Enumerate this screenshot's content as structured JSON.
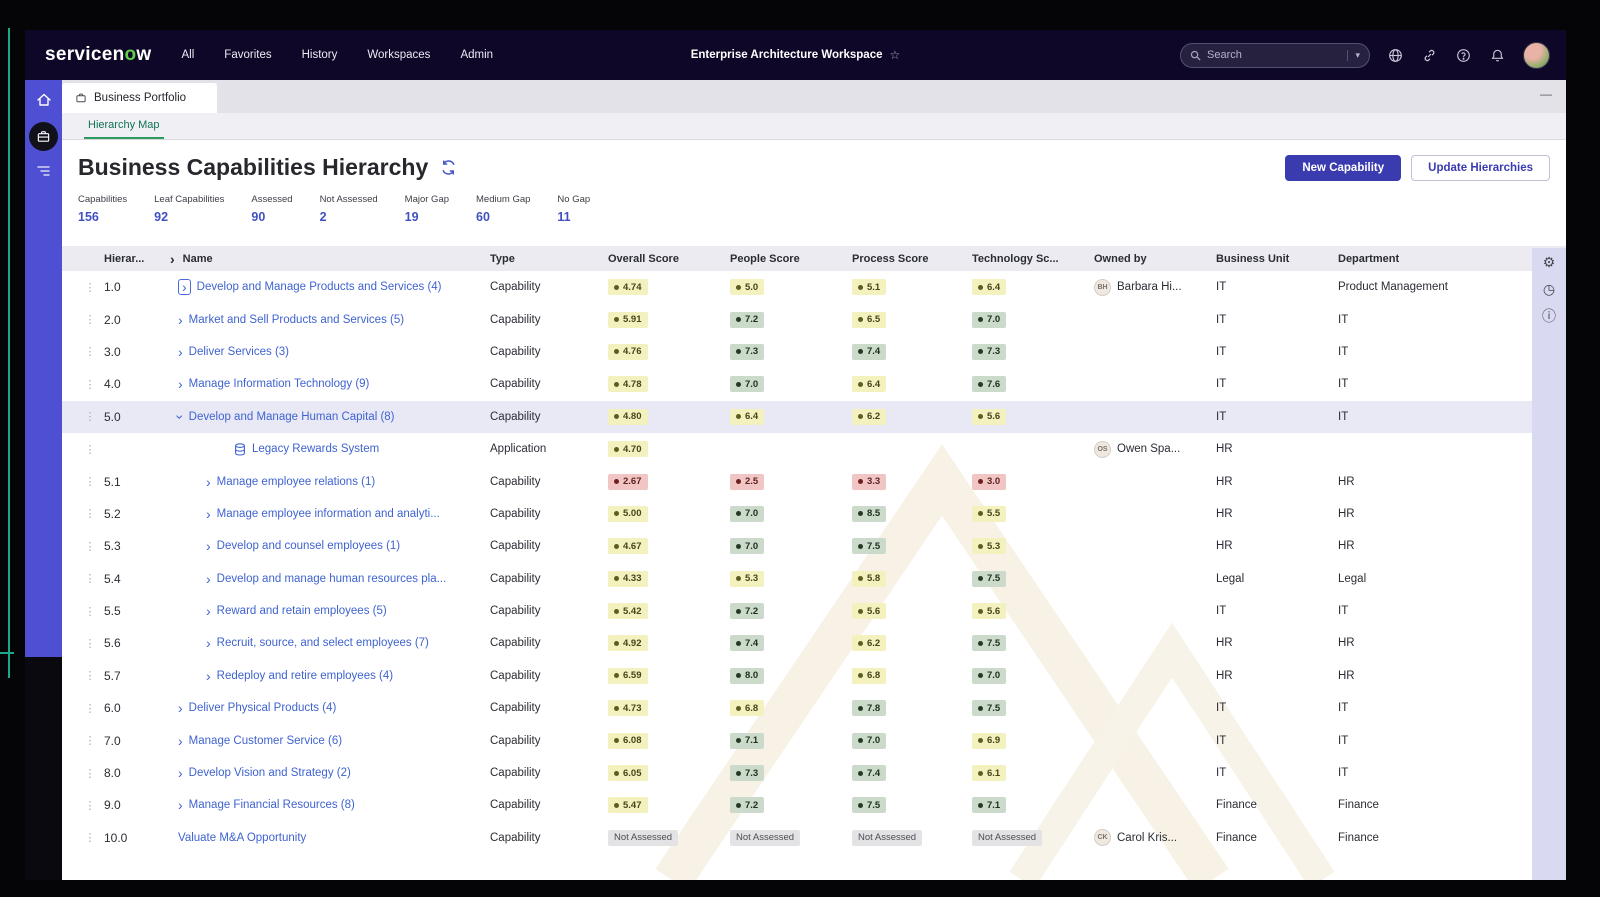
{
  "topnav": {
    "logo": "servicenow",
    "menu": [
      "All",
      "Favorites",
      "History",
      "Workspaces",
      "Admin"
    ],
    "workspace_title": "Enterprise Architecture Workspace",
    "search_placeholder": "Search",
    "icons": [
      "globe-icon",
      "link-icon",
      "help-icon",
      "bell-icon",
      "user-avatar"
    ]
  },
  "tabs": {
    "main_tab": "Business Portfolio",
    "sub_tab": "Hierarchy Map"
  },
  "page": {
    "title": "Business Capabilities Hierarchy",
    "buttons": {
      "primary": "New Capability",
      "secondary": "Update Hierarchies"
    },
    "stats": [
      {
        "label": "Capabilities",
        "value": "156"
      },
      {
        "label": "Leaf Capabilities",
        "value": "92"
      },
      {
        "label": "Assessed",
        "value": "90"
      },
      {
        "label": "Not Assessed",
        "value": "2"
      },
      {
        "label": "Major Gap",
        "value": "19"
      },
      {
        "label": "Medium Gap",
        "value": "60"
      },
      {
        "label": "No Gap",
        "value": "11"
      }
    ]
  },
  "table": {
    "headers": [
      "Hierar...",
      "Name",
      "Type",
      "Overall Score",
      "People Score",
      "Process Score",
      "Technology Sc...",
      "Owned by",
      "Business Unit",
      "Department"
    ],
    "rows": [
      {
        "hier": "1.0",
        "indent": 0,
        "chevron": "right",
        "chevron_focus": true,
        "icon": null,
        "name": "Develop and Manage Products and Services (4)",
        "type": "Capability",
        "scores": {
          "overall": {
            "v": "4.74",
            "tone": "yellow"
          },
          "people": {
            "v": "5.0",
            "tone": "yellow"
          },
          "process": {
            "v": "5.1",
            "tone": "yellow"
          },
          "technology": {
            "v": "6.4",
            "tone": "yellow"
          }
        },
        "owner": {
          "initials": "BH",
          "name": "Barbara Hi..."
        },
        "business_unit": "IT",
        "department": "Product Management",
        "selected": false
      },
      {
        "hier": "2.0",
        "indent": 0,
        "chevron": "right",
        "chevron_focus": false,
        "icon": null,
        "name": "Market and Sell Products and Services (5)",
        "type": "Capability",
        "scores": {
          "overall": {
            "v": "5.91",
            "tone": "yellow"
          },
          "people": {
            "v": "7.2",
            "tone": "green"
          },
          "process": {
            "v": "6.5",
            "tone": "yellow"
          },
          "technology": {
            "v": "7.0",
            "tone": "green"
          }
        },
        "owner": null,
        "business_unit": "IT",
        "department": "IT",
        "selected": false
      },
      {
        "hier": "3.0",
        "indent": 0,
        "chevron": "right",
        "chevron_focus": false,
        "icon": null,
        "name": "Deliver Services (3)",
        "type": "Capability",
        "scores": {
          "overall": {
            "v": "4.76",
            "tone": "yellow"
          },
          "people": {
            "v": "7.3",
            "tone": "green"
          },
          "process": {
            "v": "7.4",
            "tone": "green"
          },
          "technology": {
            "v": "7.3",
            "tone": "green"
          }
        },
        "owner": null,
        "business_unit": "IT",
        "department": "IT",
        "selected": false
      },
      {
        "hier": "4.0",
        "indent": 0,
        "chevron": "right",
        "chevron_focus": false,
        "icon": null,
        "name": "Manage Information Technology (9)",
        "type": "Capability",
        "scores": {
          "overall": {
            "v": "4.78",
            "tone": "yellow"
          },
          "people": {
            "v": "7.0",
            "tone": "green"
          },
          "process": {
            "v": "6.4",
            "tone": "yellow"
          },
          "technology": {
            "v": "7.6",
            "tone": "green"
          }
        },
        "owner": null,
        "business_unit": "IT",
        "department": "IT",
        "selected": false
      },
      {
        "hier": "5.0",
        "indent": 0,
        "chevron": "down",
        "chevron_focus": false,
        "icon": null,
        "name": "Develop and Manage Human Capital (8)",
        "type": "Capability",
        "scores": {
          "overall": {
            "v": "4.80",
            "tone": "yellow"
          },
          "people": {
            "v": "6.4",
            "tone": "yellow"
          },
          "process": {
            "v": "6.2",
            "tone": "yellow"
          },
          "technology": {
            "v": "5.6",
            "tone": "yellow"
          }
        },
        "owner": null,
        "business_unit": "IT",
        "department": "IT",
        "selected": true
      },
      {
        "hier": "",
        "indent": 2,
        "chevron": null,
        "chevron_focus": false,
        "icon": "database",
        "name": "Legacy Rewards System",
        "type": "Application",
        "scores": {
          "overall": {
            "v": "4.70",
            "tone": "yellow"
          },
          "people": null,
          "process": null,
          "technology": null
        },
        "owner": {
          "initials": "OS",
          "name": "Owen Spa..."
        },
        "business_unit": "HR",
        "department": "",
        "selected": false
      },
      {
        "hier": "5.1",
        "indent": 1,
        "chevron": "right",
        "chevron_focus": false,
        "icon": null,
        "name": "Manage employee relations (1)",
        "type": "Capability",
        "scores": {
          "overall": {
            "v": "2.67",
            "tone": "red"
          },
          "people": {
            "v": "2.5",
            "tone": "red"
          },
          "process": {
            "v": "3.3",
            "tone": "red"
          },
          "technology": {
            "v": "3.0",
            "tone": "red"
          }
        },
        "owner": null,
        "business_unit": "HR",
        "department": "HR",
        "selected": false
      },
      {
        "hier": "5.2",
        "indent": 1,
        "chevron": "right",
        "chevron_focus": false,
        "icon": null,
        "name": "Manage employee information and analyti...",
        "type": "Capability",
        "scores": {
          "overall": {
            "v": "5.00",
            "tone": "yellow"
          },
          "people": {
            "v": "7.0",
            "tone": "green"
          },
          "process": {
            "v": "8.5",
            "tone": "green"
          },
          "technology": {
            "v": "5.5",
            "tone": "yellow"
          }
        },
        "owner": null,
        "business_unit": "HR",
        "department": "HR",
        "selected": false
      },
      {
        "hier": "5.3",
        "indent": 1,
        "chevron": "right",
        "chevron_focus": false,
        "icon": null,
        "name": "Develop and counsel employees (1)",
        "type": "Capability",
        "scores": {
          "overall": {
            "v": "4.67",
            "tone": "yellow"
          },
          "people": {
            "v": "7.0",
            "tone": "green"
          },
          "process": {
            "v": "7.5",
            "tone": "green"
          },
          "technology": {
            "v": "5.3",
            "tone": "yellow"
          }
        },
        "owner": null,
        "business_unit": "HR",
        "department": "HR",
        "selected": false
      },
      {
        "hier": "5.4",
        "indent": 1,
        "chevron": "right",
        "chevron_focus": false,
        "icon": null,
        "name": "Develop and manage human resources pla...",
        "type": "Capability",
        "scores": {
          "overall": {
            "v": "4.33",
            "tone": "yellow"
          },
          "people": {
            "v": "5.3",
            "tone": "yellow"
          },
          "process": {
            "v": "5.8",
            "tone": "yellow"
          },
          "technology": {
            "v": "7.5",
            "tone": "green"
          }
        },
        "owner": null,
        "business_unit": "Legal",
        "department": "Legal",
        "selected": false
      },
      {
        "hier": "5.5",
        "indent": 1,
        "chevron": "right",
        "chevron_focus": false,
        "icon": null,
        "name": "Reward and retain employees (5)",
        "type": "Capability",
        "scores": {
          "overall": {
            "v": "5.42",
            "tone": "yellow"
          },
          "people": {
            "v": "7.2",
            "tone": "green"
          },
          "process": {
            "v": "5.6",
            "tone": "yellow"
          },
          "technology": {
            "v": "5.6",
            "tone": "yellow"
          }
        },
        "owner": null,
        "business_unit": "IT",
        "department": "IT",
        "selected": false
      },
      {
        "hier": "5.6",
        "indent": 1,
        "chevron": "right",
        "chevron_focus": false,
        "icon": null,
        "name": "Recruit, source, and select employees (7)",
        "type": "Capability",
        "scores": {
          "overall": {
            "v": "4.92",
            "tone": "yellow"
          },
          "people": {
            "v": "7.4",
            "tone": "green"
          },
          "process": {
            "v": "6.2",
            "tone": "yellow"
          },
          "technology": {
            "v": "7.5",
            "tone": "green"
          }
        },
        "owner": null,
        "business_unit": "HR",
        "department": "HR",
        "selected": false
      },
      {
        "hier": "5.7",
        "indent": 1,
        "chevron": "right",
        "chevron_focus": false,
        "icon": null,
        "name": "Redeploy and retire employees (4)",
        "type": "Capability",
        "scores": {
          "overall": {
            "v": "6.59",
            "tone": "yellow"
          },
          "people": {
            "v": "8.0",
            "tone": "green"
          },
          "process": {
            "v": "6.8",
            "tone": "yellow"
          },
          "technology": {
            "v": "7.0",
            "tone": "green"
          }
        },
        "owner": null,
        "business_unit": "HR",
        "department": "HR",
        "selected": false
      },
      {
        "hier": "6.0",
        "indent": 0,
        "chevron": "right",
        "chevron_focus": false,
        "icon": null,
        "name": "Deliver Physical Products (4)",
        "type": "Capability",
        "scores": {
          "overall": {
            "v": "4.73",
            "tone": "yellow"
          },
          "people": {
            "v": "6.8",
            "tone": "yellow"
          },
          "process": {
            "v": "7.8",
            "tone": "green"
          },
          "technology": {
            "v": "7.5",
            "tone": "green"
          }
        },
        "owner": null,
        "business_unit": "IT",
        "department": "IT",
        "selected": false
      },
      {
        "hier": "7.0",
        "indent": 0,
        "chevron": "right",
        "chevron_focus": false,
        "icon": null,
        "name": "Manage Customer Service (6)",
        "type": "Capability",
        "scores": {
          "overall": {
            "v": "6.08",
            "tone": "yellow"
          },
          "people": {
            "v": "7.1",
            "tone": "green"
          },
          "process": {
            "v": "7.0",
            "tone": "green"
          },
          "technology": {
            "v": "6.9",
            "tone": "yellow"
          }
        },
        "owner": null,
        "business_unit": "IT",
        "department": "IT",
        "selected": false
      },
      {
        "hier": "8.0",
        "indent": 0,
        "chevron": "right",
        "chevron_focus": false,
        "icon": null,
        "name": "Develop Vision and Strategy (2)",
        "type": "Capability",
        "scores": {
          "overall": {
            "v": "6.05",
            "tone": "yellow"
          },
          "people": {
            "v": "7.3",
            "tone": "green"
          },
          "process": {
            "v": "7.4",
            "tone": "green"
          },
          "technology": {
            "v": "6.1",
            "tone": "yellow"
          }
        },
        "owner": null,
        "business_unit": "IT",
        "department": "IT",
        "selected": false
      },
      {
        "hier": "9.0",
        "indent": 0,
        "chevron": "right",
        "chevron_focus": false,
        "icon": null,
        "name": "Manage Financial Resources (8)",
        "type": "Capability",
        "scores": {
          "overall": {
            "v": "5.47",
            "tone": "yellow"
          },
          "people": {
            "v": "7.2",
            "tone": "green"
          },
          "process": {
            "v": "7.5",
            "tone": "green"
          },
          "technology": {
            "v": "7.1",
            "tone": "green"
          }
        },
        "owner": null,
        "business_unit": "Finance",
        "department": "Finance",
        "selected": false
      },
      {
        "hier": "10.0",
        "indent": 0,
        "chevron": null,
        "chevron_focus": false,
        "icon": null,
        "name": "Valuate M&A Opportunity",
        "type": "Capability",
        "scores": {
          "overall": {
            "v": "Not Assessed",
            "tone": "na"
          },
          "people": {
            "v": "Not Assessed",
            "tone": "na"
          },
          "process": {
            "v": "Not Assessed",
            "tone": "na"
          },
          "technology": {
            "v": "Not Assessed",
            "tone": "na"
          }
        },
        "owner": {
          "initials": "CK",
          "name": "Carol Kris..."
        },
        "business_unit": "Finance",
        "department": "Finance",
        "selected": false
      }
    ]
  },
  "right_strip_icons": [
    "settings-icon",
    "history-clock-icon",
    "info-icon"
  ],
  "colors": {
    "navbar_bg": "#0e0727",
    "sidebar_bg": "#4f4fd4",
    "primary_button": "#3b3bb0",
    "link_blue": "#3f63d0",
    "stat_blue": "#3f51c0",
    "subtab_green": "#0f7257",
    "badge_yellow": "#f3f1bd",
    "badge_green": "#cbdaca",
    "badge_red": "#f2c5c5",
    "selected_row": "#e9e9f6",
    "header_row": "#ebebf1",
    "right_strip": "#d9d9f2"
  }
}
